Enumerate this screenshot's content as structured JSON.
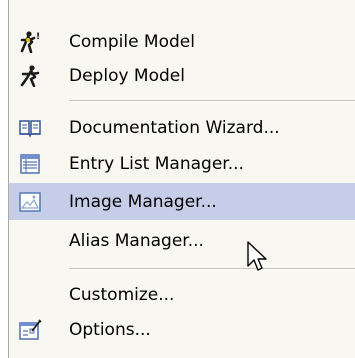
{
  "colors": {
    "menu_bg": "#f8f7f2",
    "highlight": "#c6cde8",
    "separator": "#c6c3b8"
  },
  "menu": {
    "items": [
      {
        "label": "Compile Model",
        "icon": "compile-runner-icon"
      },
      {
        "label": "Deploy Model",
        "icon": "deploy-runner-icon"
      },
      {
        "label": "Documentation Wizard...",
        "icon": "book-icon"
      },
      {
        "label": "Entry List Manager...",
        "icon": "list-icon"
      },
      {
        "label": "Image Manager...",
        "icon": "image-icon",
        "state": "hover"
      },
      {
        "label": "Alias Manager...",
        "icon": ""
      },
      {
        "label": "Customize...",
        "icon": ""
      },
      {
        "label": "Options...",
        "icon": "options-icon"
      }
    ]
  }
}
